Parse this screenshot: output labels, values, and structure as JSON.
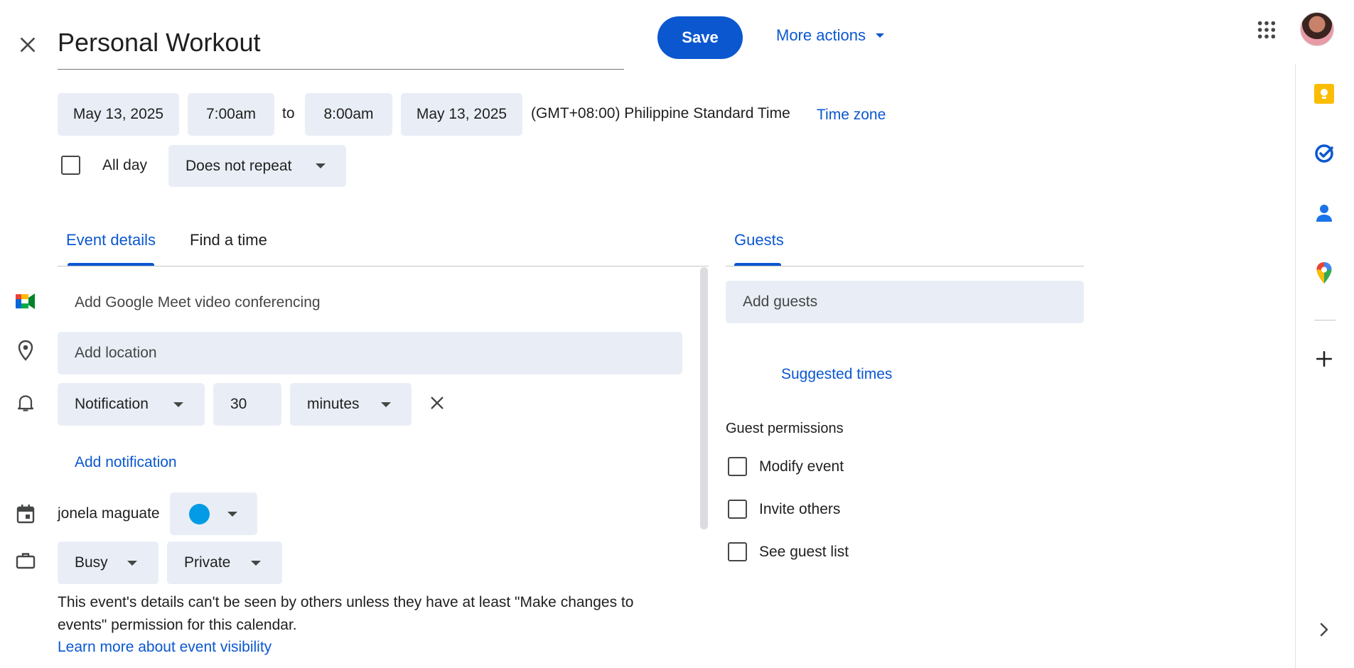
{
  "header": {
    "close_icon": "close-icon",
    "title": "Personal Workout",
    "save_label": "Save",
    "more_actions_label": "More actions"
  },
  "datetime": {
    "start_date": "May 13, 2025",
    "start_time": "7:00am",
    "to_label": "to",
    "end_time": "8:00am",
    "end_date": "May 13, 2025",
    "timezone_text": "(GMT+08:00) Philippine Standard Time",
    "timezone_link": "Time zone",
    "all_day_label": "All day",
    "repeat_value": "Does not repeat"
  },
  "tabs": {
    "event_details": "Event details",
    "find_a_time": "Find a time",
    "guests": "Guests"
  },
  "details": {
    "meet_label": "Add Google Meet video conferencing",
    "location_placeholder": "Add location",
    "notification_type": "Notification",
    "notification_value": "30",
    "notification_unit": "minutes",
    "add_notification": "Add notification",
    "calendar_owner": "jonela maguate",
    "calendar_color": "#039be5",
    "availability": "Busy",
    "visibility": "Private",
    "visibility_help": "This event's details can't be seen by others unless they have at least \"Make changes to events\" permission for this calendar.",
    "visibility_link": "Learn more about event visibility"
  },
  "guests": {
    "add_placeholder": "Add guests",
    "suggested_times": "Suggested times",
    "permissions_title": "Guest permissions",
    "permissions": [
      {
        "label": "Modify event"
      },
      {
        "label": "Invite others"
      },
      {
        "label": "See guest list"
      }
    ]
  },
  "colors": {
    "accent": "#0b57d0",
    "chip_bg": "#e9eef6"
  }
}
